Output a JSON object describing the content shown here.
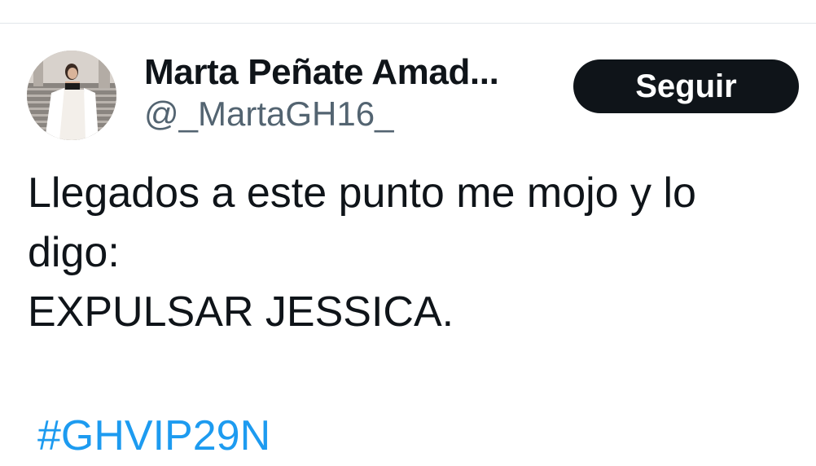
{
  "author": {
    "display_name": "Marta Peñate Amad...",
    "handle": "@_MartaGH16_"
  },
  "follow_button": {
    "label": "Seguir"
  },
  "tweet": {
    "lines": [
      "Llegados a este punto me mojo y lo",
      "digo:",
      "EXPULSAR JESSICA."
    ],
    "hashtag": "#GHVIP29N"
  },
  "colors": {
    "text_primary": "#0f1419",
    "text_secondary": "#536471",
    "link": "#1d9bf0",
    "button_bg": "#0f1419"
  }
}
